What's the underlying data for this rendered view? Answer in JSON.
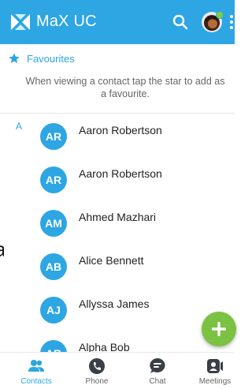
{
  "colors": {
    "primary": "#2da6e3",
    "accent": "#7cc242",
    "status_online": "#7cd13a"
  },
  "appbar": {
    "title": "MaX UC",
    "logo_icon": "max-uc-logo-icon",
    "search_icon": "search-icon",
    "more_icon": "more-vert-icon"
  },
  "favourites": {
    "label": "Favourites",
    "hint": "When viewing a contact tap the star to add as a favourite."
  },
  "list": {
    "section": "A",
    "contacts": [
      {
        "initials": "AR",
        "name": "Aaron Robertson"
      },
      {
        "initials": "AR",
        "name": "Aaron Robertson"
      },
      {
        "initials": "AM",
        "name": "Ahmed Mazhari"
      },
      {
        "initials": "AB",
        "name": "Alice Bennett"
      },
      {
        "initials": "AJ",
        "name": "Allyssa James"
      },
      {
        "initials": "AB",
        "name": "Alpha Bob"
      }
    ]
  },
  "edge_char": "a",
  "fab": {
    "icon": "plus-icon"
  },
  "bottom_nav": {
    "items": [
      {
        "label": "Contacts",
        "icon": "contacts-icon",
        "active": true
      },
      {
        "label": "Phone",
        "icon": "phone-icon",
        "active": false
      },
      {
        "label": "Chat",
        "icon": "chat-icon",
        "active": false
      },
      {
        "label": "Meetings",
        "icon": "meetings-icon",
        "active": false
      }
    ]
  }
}
